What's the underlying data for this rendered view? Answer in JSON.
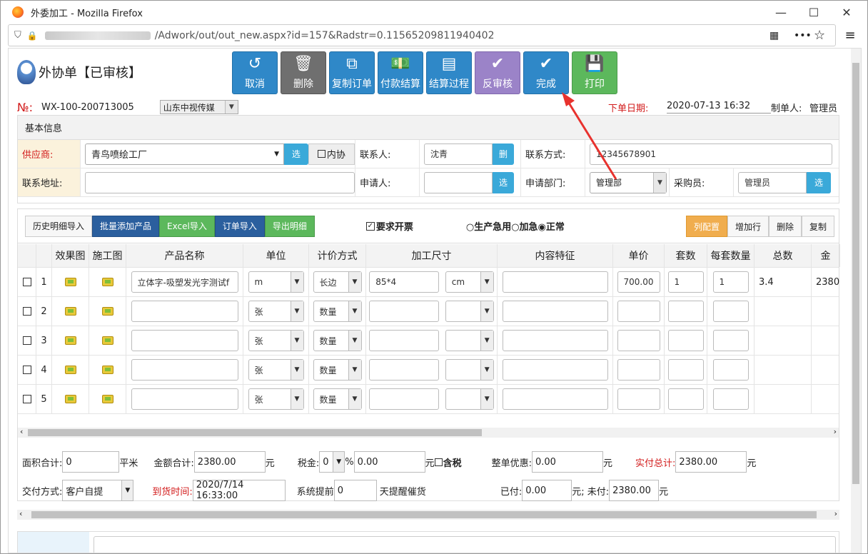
{
  "window": {
    "title": "外委加工 - Mozilla Firefox",
    "minimize": "—",
    "maximize": "☐",
    "close": "✕"
  },
  "url": {
    "tail": "/Adwork/out/out_new.aspx?id=157&Radstr=0.11565209811940402"
  },
  "header": {
    "title": "外协单【已审核】"
  },
  "toolbar": [
    {
      "label": "取消",
      "icon": "↺",
      "color": "#2f88c8"
    },
    {
      "label": "删除",
      "icon": "🗑",
      "color": "#6f6f6f"
    },
    {
      "label": "复制订单",
      "icon": "⧉",
      "color": "#2f88c8"
    },
    {
      "label": "付款结算",
      "icon": "💵",
      "color": "#2f88c8"
    },
    {
      "label": "结算过程",
      "icon": "▤",
      "color": "#2f88c8"
    },
    {
      "label": "反审核",
      "icon": "✔",
      "color": "#9b83c8"
    },
    {
      "label": "完成",
      "icon": "✔",
      "color": "#2f88c8"
    },
    {
      "label": "打印",
      "icon": "💾",
      "color": "#5cb85c"
    }
  ],
  "order": {
    "no_label": "№:",
    "no": "WX-100-200713005",
    "company": "山东中视传媒",
    "date_label": "下单日期:",
    "date": "2020-07-13 16:32",
    "maker_label": "制单人:",
    "maker": "管理员"
  },
  "basic": {
    "title": "基本信息",
    "supplier_label": "供应商:",
    "supplier": "青鸟喷绘工厂",
    "pick": "选",
    "internal": "内协",
    "contact_label": "联系人:",
    "contact": "沈青",
    "del": "删",
    "phone_label": "联系方式:",
    "phone": "12345678901",
    "address_label": "联系地址:",
    "address": "",
    "applicant_label": "申请人:",
    "applicant": "",
    "pick2": "选",
    "dept_label": "申请部门:",
    "dept": "管理部",
    "buyer_label": "采购员:",
    "buyer": "管理员",
    "pick3": "选"
  },
  "gridbar": {
    "history": "历史明细导入",
    "batch": "批量添加产品",
    "excel": "Excel导入",
    "order_import": "订单导入",
    "export": "导出明细",
    "invoice": "要求开票",
    "urgency": "○生产急用○加急◉正常",
    "col_config": "列配置",
    "add_row": "增加行",
    "delete": "删除",
    "copy": "复制"
  },
  "table": {
    "headers": [
      "",
      "",
      "效果图",
      "施工图",
      "产品名称",
      "单位",
      "计价方式",
      "加工尺寸",
      "内容特征",
      "单价",
      "套数",
      "每套数量",
      "总数",
      "金"
    ],
    "rows": [
      {
        "n": "1",
        "name": "立体字-吸塑发光字测试f",
        "unit": "m",
        "price_method": "长边",
        "size": "85*4",
        "size_unit": "cm",
        "feature": "",
        "price": "700.00",
        "sets": "1",
        "qty": "1",
        "total": "3.4",
        "amount": "2380."
      },
      {
        "n": "2",
        "name": "",
        "unit": "张",
        "price_method": "数量",
        "size": "",
        "size_unit": "",
        "feature": "",
        "price": "",
        "sets": "",
        "qty": "",
        "total": "",
        "amount": ""
      },
      {
        "n": "3",
        "name": "",
        "unit": "张",
        "price_method": "数量",
        "size": "",
        "size_unit": "",
        "feature": "",
        "price": "",
        "sets": "",
        "qty": "",
        "total": "",
        "amount": ""
      },
      {
        "n": "4",
        "name": "",
        "unit": "张",
        "price_method": "数量",
        "size": "",
        "size_unit": "",
        "feature": "",
        "price": "",
        "sets": "",
        "qty": "",
        "total": "",
        "amount": ""
      },
      {
        "n": "5",
        "name": "",
        "unit": "张",
        "price_method": "数量",
        "size": "",
        "size_unit": "",
        "feature": "",
        "price": "",
        "sets": "",
        "qty": "",
        "total": "",
        "amount": ""
      }
    ]
  },
  "summary": {
    "area_label": "面积合计:",
    "area": "0",
    "area_unit": "平米",
    "amount_label": "金额合计:",
    "amount": "2380.00",
    "yuan": "元",
    "tax_label": "税金:",
    "tax_rate": "0",
    "pct": "%",
    "tax": "0.00",
    "tax_incl": "含税",
    "discount_label": "整单优惠:",
    "discount": "0.00",
    "actual_label": "实付总计:",
    "actual": "2380.00",
    "delivery_label": "交付方式:",
    "delivery": "客户自提",
    "arrival_label": "到货时间:",
    "arrival": "2020/7/14 16:33:00",
    "remind_label": "系统提前",
    "remind": "0",
    "remind_unit": "天提醒催货",
    "paid_label": "已付:",
    "paid": "0.00",
    "unpaid_label": "元; 未付:",
    "unpaid": "2380.00"
  }
}
